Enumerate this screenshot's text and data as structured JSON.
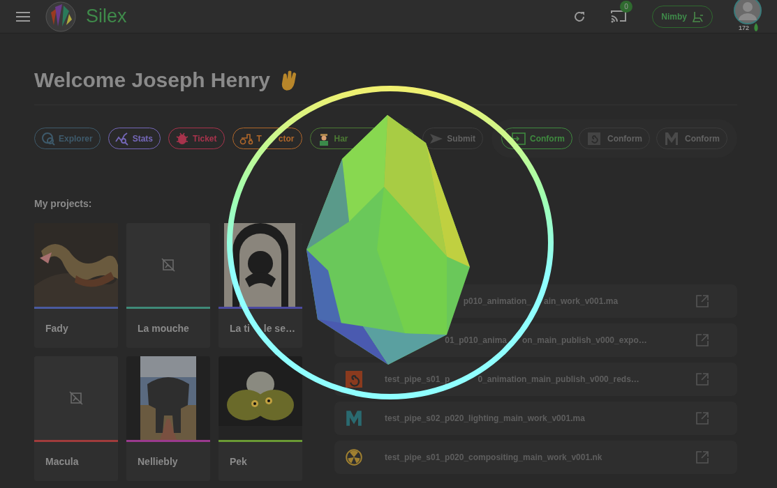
{
  "app_bar": {
    "brand": "Silex",
    "notifications_badge": "0",
    "nimby_label": "Nimby",
    "user_count": "172"
  },
  "welcome": {
    "title": "Welcome Joseph Henry"
  },
  "tools": [
    {
      "label": "Explorer",
      "kind": "explorer",
      "color": "#3e5a6b",
      "disabled": false
    },
    {
      "label": "Stats",
      "kind": "stats",
      "color": "#7467b8",
      "disabled": false
    },
    {
      "label": "Ticket",
      "kind": "ticket",
      "color": "#a8334c",
      "disabled": false
    },
    {
      "label": [
        "T",
        "ctor"
      ],
      "kind": "tractor",
      "color": "#b0672a",
      "disabled": false
    },
    {
      "label": "Har",
      "kind": "harvest",
      "color": "#4c7a34",
      "disabled": false
    },
    {
      "label": "Submit",
      "kind": "submit",
      "disabled": true
    }
  ],
  "conform_tools": [
    {
      "label": "Conform",
      "kind": "conform",
      "color": "#3f8a3f",
      "disabled": false
    },
    {
      "label": "Conform",
      "kind": "houdini",
      "disabled": true
    },
    {
      "label": "Conform",
      "kind": "maya",
      "disabled": true
    }
  ],
  "projects": {
    "heading": "My projects:",
    "items": [
      {
        "name": "Fady",
        "thumbnail": true,
        "color": "#4a5aa0"
      },
      {
        "name": "La mouche",
        "thumbnail": false,
        "color": "#3f8a78"
      },
      {
        "name": [
          "La ti",
          "le se…"
        ],
        "thumbnail": true,
        "color": "#4c4aa0"
      },
      {
        "name": "Macula",
        "thumbnail": false,
        "color": "#a03c3c"
      },
      {
        "name": "Nelliebly",
        "thumbnail": true,
        "color": "#9a3a8e"
      },
      {
        "name": "Pek",
        "thumbnail": true,
        "color": "#6a9a34"
      }
    ]
  },
  "recent_files": [
    {
      "name": [
        "p010_animation_",
        "ain_work_v001.ma"
      ]
    },
    {
      "name": [
        "01_p010_anima",
        "on_main_publish_v000_expo…"
      ]
    },
    {
      "name": [
        "test_pipe_s01_p",
        "0_animation_main_publish_v000_reds…"
      ],
      "kind": "houdini"
    },
    {
      "name": "test_pipe_s02_p020_lighting_main_work_v001.ma",
      "kind": "maya"
    },
    {
      "name": "test_pipe_s01_p020_compositing_main_work_v001.nk",
      "kind": "nuke"
    }
  ]
}
